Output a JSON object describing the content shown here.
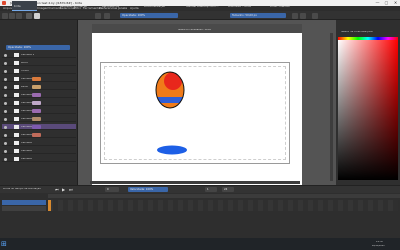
{
  "window": {
    "title": "[sauvetas animation test 2.ky (/1870.8#] - Krita",
    "minimize": "—",
    "maximize": "▢",
    "close": "✕"
  },
  "menu": [
    "Arquivo",
    "Editar",
    "Exibir",
    "Imagem",
    "Camada",
    "Selecionar",
    "Filtro",
    "Ferramentas",
    "Preferências",
    "Janela",
    "Ajuda"
  ],
  "toolbar": {
    "opacity_field": "Opacidade: 100%",
    "size_field": "Tamanho: 50,00 px"
  },
  "left_panel": {
    "header": "Opacidade: 100%",
    "layers": [
      {
        "name": "Camada 1",
        "chip": ""
      },
      {
        "name": "bloco",
        "chip": ""
      },
      {
        "name": "Fundo",
        "chip": ""
      },
      {
        "name": "Camada",
        "chip": "#d97a3c"
      },
      {
        "name": "Parte",
        "chip": "#c9a06b"
      },
      {
        "name": "Camada",
        "chip": "#9b6bb0"
      },
      {
        "name": "Camada",
        "chip": "#c0a9c9"
      },
      {
        "name": "Camada",
        "chip": "#9b6bb0"
      },
      {
        "name": "Camada",
        "chip": "#b08c6b"
      },
      {
        "name": "Camada",
        "chip": "#7e5ab0"
      },
      {
        "name": "Camada",
        "chip": "#c06b5a"
      },
      {
        "name": "Camada",
        "chip": ""
      },
      {
        "name": "Camada",
        "chip": ""
      },
      {
        "name": "Camada",
        "chip": ""
      }
    ],
    "selected_index": 9
  },
  "canvas": {
    "top_label": "Sobre ho cumulativo - Krita",
    "colors": {
      "ball_top": "#e8271c",
      "ball_bottom": "#f07b1a",
      "ball_band": "#2f5fd8",
      "shadow": "#1d5fe6",
      "outline": "#111111"
    }
  },
  "right_panel": {
    "header": "Seletor de cores avançado",
    "colors": {
      "accent": "#ff0000"
    }
  },
  "timeline": {
    "header": "Linha do tempo da animação",
    "frame_field": "0",
    "speed_field": "Velocidade: 100%",
    "start": "1",
    "end": "24"
  },
  "taskbar": {
    "items": [
      "Krita",
      "sauvetas animação",
      "Recursos de",
      "Documentação",
      "Manual Desktop Com...",
      "Animador - Krita",
      "Krita - Manual"
    ],
    "clock": "15:43",
    "date": "26/11/2021"
  }
}
